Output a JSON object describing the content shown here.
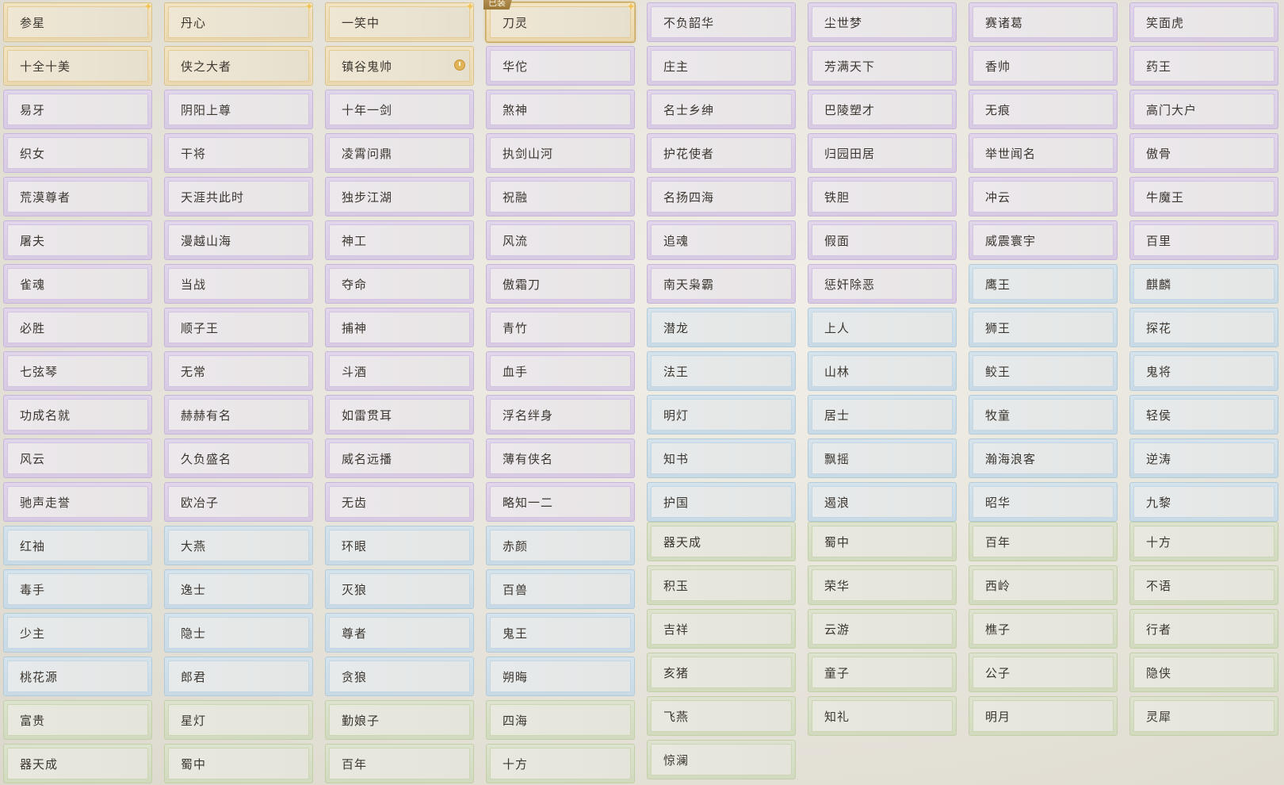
{
  "badges": {
    "equipped": "已装"
  },
  "columns": [
    {
      "tiles": [
        {
          "label": "参星",
          "tier": "gold"
        },
        {
          "label": "十全十美",
          "tier": "gold"
        },
        {
          "label": "易牙",
          "tier": "purple"
        },
        {
          "label": "织女",
          "tier": "purple"
        },
        {
          "label": "荒漠尊者",
          "tier": "purple"
        },
        {
          "label": "屠夫",
          "tier": "purple"
        },
        {
          "label": "雀魂",
          "tier": "purple"
        },
        {
          "label": "必胜",
          "tier": "purple"
        },
        {
          "label": "七弦琴",
          "tier": "purple"
        },
        {
          "label": "功成名就",
          "tier": "purple"
        },
        {
          "label": "风云",
          "tier": "purple"
        },
        {
          "label": "驰声走誉",
          "tier": "purple"
        },
        {
          "label": "红袖",
          "tier": "blue"
        },
        {
          "label": "毒手",
          "tier": "blue"
        },
        {
          "label": "少主",
          "tier": "blue"
        },
        {
          "label": "桃花源",
          "tier": "blue"
        },
        {
          "label": "富贵",
          "tier": "green"
        },
        {
          "label": "器天成",
          "tier": "green"
        }
      ]
    },
    {
      "tiles": [
        {
          "label": "丹心",
          "tier": "gold"
        },
        {
          "label": "侠之大者",
          "tier": "gold"
        },
        {
          "label": "阴阳上尊",
          "tier": "purple"
        },
        {
          "label": "干将",
          "tier": "purple"
        },
        {
          "label": "天涯共此时",
          "tier": "purple"
        },
        {
          "label": "漫越山海",
          "tier": "purple"
        },
        {
          "label": "当战",
          "tier": "purple"
        },
        {
          "label": "顺子王",
          "tier": "purple"
        },
        {
          "label": "无常",
          "tier": "purple"
        },
        {
          "label": "赫赫有名",
          "tier": "purple"
        },
        {
          "label": "久负盛名",
          "tier": "purple"
        },
        {
          "label": "欧冶子",
          "tier": "purple"
        },
        {
          "label": "大燕",
          "tier": "blue"
        },
        {
          "label": "逸士",
          "tier": "blue"
        },
        {
          "label": "隐士",
          "tier": "blue"
        },
        {
          "label": "郎君",
          "tier": "blue"
        },
        {
          "label": "星灯",
          "tier": "green"
        },
        {
          "label": "蜀中",
          "tier": "green"
        }
      ]
    },
    {
      "tiles": [
        {
          "label": "一笑中",
          "tier": "gold"
        },
        {
          "label": "镇谷鬼帅",
          "tier": "gold",
          "clock": true
        },
        {
          "label": "十年一剑",
          "tier": "purple"
        },
        {
          "label": "凌霄问鼎",
          "tier": "purple"
        },
        {
          "label": "独步江湖",
          "tier": "purple"
        },
        {
          "label": "神工",
          "tier": "purple"
        },
        {
          "label": "夺命",
          "tier": "purple"
        },
        {
          "label": "捕神",
          "tier": "purple"
        },
        {
          "label": "斗酒",
          "tier": "purple"
        },
        {
          "label": "如雷贯耳",
          "tier": "purple"
        },
        {
          "label": "威名远播",
          "tier": "purple"
        },
        {
          "label": "无齿",
          "tier": "purple"
        },
        {
          "label": "环眼",
          "tier": "blue"
        },
        {
          "label": "灭狼",
          "tier": "blue"
        },
        {
          "label": "尊者",
          "tier": "blue"
        },
        {
          "label": "贪狼",
          "tier": "blue"
        },
        {
          "label": "勤娘子",
          "tier": "green"
        },
        {
          "label": "百年",
          "tier": "green"
        }
      ]
    },
    {
      "tiles": [
        {
          "label": "刀灵",
          "tier": "gold",
          "equipped": true
        },
        {
          "label": "华佗",
          "tier": "purple"
        },
        {
          "label": "煞神",
          "tier": "purple"
        },
        {
          "label": "执剑山河",
          "tier": "purple"
        },
        {
          "label": "祝融",
          "tier": "purple"
        },
        {
          "label": "风流",
          "tier": "purple"
        },
        {
          "label": "傲霜刀",
          "tier": "purple"
        },
        {
          "label": "青竹",
          "tier": "purple"
        },
        {
          "label": "血手",
          "tier": "purple"
        },
        {
          "label": "浮名绊身",
          "tier": "purple"
        },
        {
          "label": "薄有侠名",
          "tier": "purple"
        },
        {
          "label": "略知一二",
          "tier": "purple"
        },
        {
          "label": "赤颜",
          "tier": "blue"
        },
        {
          "label": "百兽",
          "tier": "blue"
        },
        {
          "label": "鬼王",
          "tier": "blue"
        },
        {
          "label": "朔晦",
          "tier": "blue"
        },
        {
          "label": "四海",
          "tier": "green"
        },
        {
          "label": "十方",
          "tier": "green"
        }
      ]
    },
    {
      "tiles": [
        {
          "label": "不负韶华",
          "tier": "purple"
        },
        {
          "label": "庄主",
          "tier": "purple"
        },
        {
          "label": "名士乡绅",
          "tier": "purple"
        },
        {
          "label": "护花使者",
          "tier": "purple"
        },
        {
          "label": "名扬四海",
          "tier": "purple"
        },
        {
          "label": "追魂",
          "tier": "purple"
        },
        {
          "label": "南天枭霸",
          "tier": "purple"
        },
        {
          "label": "潜龙",
          "tier": "blue"
        },
        {
          "label": "法王",
          "tier": "blue"
        },
        {
          "label": "明灯",
          "tier": "blue"
        },
        {
          "label": "知书",
          "tier": "blue"
        },
        {
          "label": "护国",
          "tier": "blue"
        },
        {
          "label": "器天成",
          "tier": "green"
        },
        {
          "label": "积玉",
          "tier": "green"
        },
        {
          "label": "吉祥",
          "tier": "green"
        },
        {
          "label": "亥猪",
          "tier": "green"
        },
        {
          "label": "飞燕",
          "tier": "green"
        },
        {
          "label": "惊澜",
          "tier": "green"
        }
      ]
    },
    {
      "tiles": [
        {
          "label": "尘世梦",
          "tier": "purple"
        },
        {
          "label": "芳满天下",
          "tier": "purple"
        },
        {
          "label": "巴陵塑才",
          "tier": "purple"
        },
        {
          "label": "归园田居",
          "tier": "purple"
        },
        {
          "label": "铁胆",
          "tier": "purple"
        },
        {
          "label": "假面",
          "tier": "purple"
        },
        {
          "label": "惩奸除恶",
          "tier": "purple"
        },
        {
          "label": "上人",
          "tier": "blue"
        },
        {
          "label": "山林",
          "tier": "blue"
        },
        {
          "label": "居士",
          "tier": "blue"
        },
        {
          "label": "飘摇",
          "tier": "blue"
        },
        {
          "label": "遏浪",
          "tier": "blue"
        },
        {
          "label": "蜀中",
          "tier": "green"
        },
        {
          "label": "荣华",
          "tier": "green"
        },
        {
          "label": "云游",
          "tier": "green"
        },
        {
          "label": "童子",
          "tier": "green"
        },
        {
          "label": "知礼",
          "tier": "green"
        }
      ]
    },
    {
      "tiles": [
        {
          "label": "赛诸葛",
          "tier": "purple"
        },
        {
          "label": "香帅",
          "tier": "purple"
        },
        {
          "label": "无痕",
          "tier": "purple"
        },
        {
          "label": "举世闻名",
          "tier": "purple"
        },
        {
          "label": "冲云",
          "tier": "purple"
        },
        {
          "label": "威震寰宇",
          "tier": "purple"
        },
        {
          "label": "鹰王",
          "tier": "blue"
        },
        {
          "label": "狮王",
          "tier": "blue"
        },
        {
          "label": "鲛王",
          "tier": "blue"
        },
        {
          "label": "牧童",
          "tier": "blue"
        },
        {
          "label": "瀚海浪客",
          "tier": "blue"
        },
        {
          "label": "昭华",
          "tier": "blue"
        },
        {
          "label": "百年",
          "tier": "green"
        },
        {
          "label": "西岭",
          "tier": "green"
        },
        {
          "label": "樵子",
          "tier": "green"
        },
        {
          "label": "公子",
          "tier": "green"
        },
        {
          "label": "明月",
          "tier": "green"
        }
      ]
    },
    {
      "tiles": [
        {
          "label": "笑面虎",
          "tier": "purple"
        },
        {
          "label": "药王",
          "tier": "purple"
        },
        {
          "label": "高门大户",
          "tier": "purple"
        },
        {
          "label": "傲骨",
          "tier": "purple"
        },
        {
          "label": "牛魔王",
          "tier": "purple"
        },
        {
          "label": "百里",
          "tier": "purple"
        },
        {
          "label": "麒麟",
          "tier": "blue"
        },
        {
          "label": "探花",
          "tier": "blue"
        },
        {
          "label": "鬼将",
          "tier": "blue"
        },
        {
          "label": "轻侯",
          "tier": "blue"
        },
        {
          "label": "逆涛",
          "tier": "blue"
        },
        {
          "label": "九黎",
          "tier": "blue"
        },
        {
          "label": "十方",
          "tier": "green"
        },
        {
          "label": "不语",
          "tier": "green"
        },
        {
          "label": "行者",
          "tier": "green"
        },
        {
          "label": "隐侠",
          "tier": "green"
        },
        {
          "label": "灵犀",
          "tier": "green"
        }
      ]
    }
  ]
}
